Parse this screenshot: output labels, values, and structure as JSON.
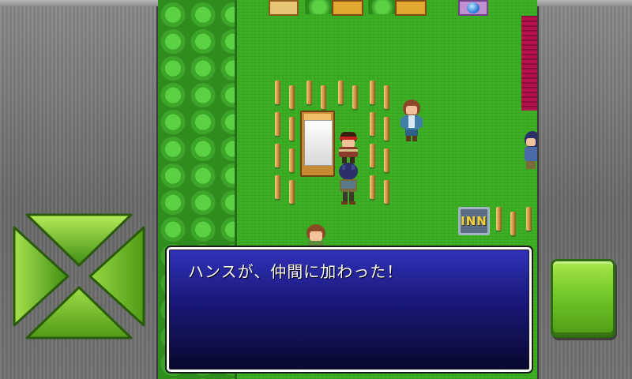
{
  "dialog": {
    "text": "ハンスが、仲間に加わった！"
  },
  "map": {
    "inn_sign": "INN"
  },
  "controls": {
    "dpad_icon": "dpad-arrows-icon",
    "action_button_icon": "square-button-icon"
  },
  "colors": {
    "grass": "#3aad22",
    "hedge": "#2f8d1e",
    "dialog_top": "#3232ba",
    "dialog_bottom": "#08082e",
    "button_green": "#73c72a",
    "panel_gray": "#7a7a7a"
  }
}
